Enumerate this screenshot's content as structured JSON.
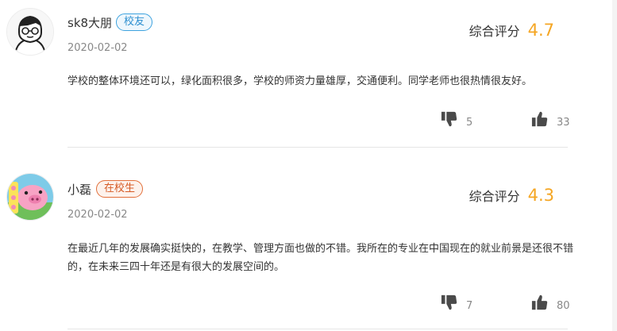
{
  "reviews": [
    {
      "username": "sk8大朋",
      "badge": "校友",
      "date": "2020-02-02",
      "rating_label": "综合评分",
      "rating_value": "4.7",
      "content": "学校的整体环境还可以，绿化面积很多，学校的师资力量雄厚，交通便利。同学老师也很热情很友好。",
      "dislike_count": "5",
      "like_count": "33",
      "avatar_icon": "sketch-face-avatar"
    },
    {
      "username": "小磊",
      "badge": "在校生",
      "date": "2020-02-02",
      "rating_label": "综合评分",
      "rating_value": "4.3",
      "content": "在最近几年的发展确实挺快的，在教学、管理方面也做的不错。我所在的专业在中国现在的就业前景是还很不错的，在未来三四十年还是有很大的发展空间的。",
      "dislike_count": "7",
      "like_count": "80",
      "avatar_icon": "pink-pig-avatar"
    }
  ],
  "colors": {
    "rating": "#f5a623",
    "alumni_badge": "#3ea3df",
    "student_badge": "#e26f3a",
    "thumb_icon": "#4a4a4a"
  }
}
